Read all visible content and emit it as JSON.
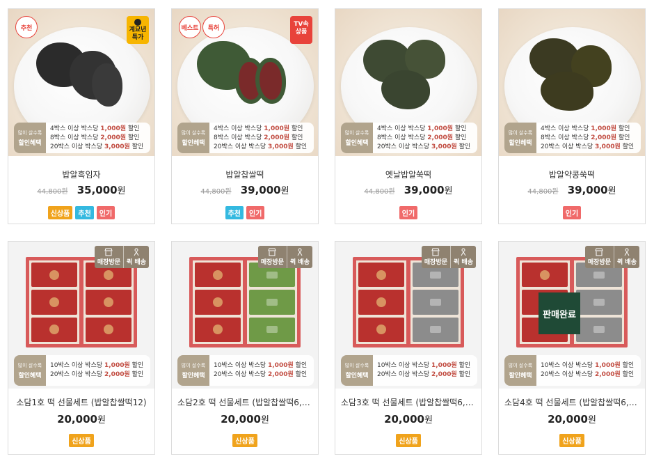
{
  "promo_label": {
    "top": "많이 살수록",
    "bottom": "할인혜택"
  },
  "pickup_tags": {
    "visit": "매장방문",
    "quick": "퀵 배송"
  },
  "sold_out": "판매완료",
  "products": [
    {
      "name": "밥알흑임자",
      "original_price": "44,800원",
      "price": "35,000",
      "price_unit": "원",
      "badges_circle": [
        "추천"
      ],
      "badge_rect": {
        "text": "계묘년\n특가",
        "color": "yellow"
      },
      "promo_lines": [
        {
          "pre": "4박스 이상 박스당 ",
          "hl": "1,000원",
          "post": " 할인"
        },
        {
          "pre": "8박스 이상 박스당 ",
          "hl": "2,000원",
          "post": " 할인"
        },
        {
          "pre": "20박스 이상 박스당 ",
          "hl": "3,000원",
          "post": " 할인"
        }
      ],
      "labels": [
        "신상품",
        "추천",
        "인기"
      ]
    },
    {
      "name": "밥알찹쌀떡",
      "original_price": "44,800원",
      "price": "39,000",
      "price_unit": "원",
      "badges_circle": [
        "베스트",
        "특허"
      ],
      "badge_rect": {
        "text": "TV속\n상품",
        "color": "red"
      },
      "promo_lines": [
        {
          "pre": "4박스 이상 박스당 ",
          "hl": "1,000원",
          "post": " 할인"
        },
        {
          "pre": "8박스 이상 박스당 ",
          "hl": "2,000원",
          "post": " 할인"
        },
        {
          "pre": "20박스 이상 박스당 ",
          "hl": "3,000원",
          "post": " 할인"
        }
      ],
      "labels": [
        "추천",
        "인기"
      ]
    },
    {
      "name": "옛날밥알쑥떡",
      "original_price": "44,800원",
      "price": "39,000",
      "price_unit": "원",
      "promo_lines": [
        {
          "pre": "4박스 이상 박스당 ",
          "hl": "1,000원",
          "post": " 할인"
        },
        {
          "pre": "8박스 이상 박스당 ",
          "hl": "2,000원",
          "post": " 할인"
        },
        {
          "pre": "20박스 이상 박스당 ",
          "hl": "3,000원",
          "post": " 할인"
        }
      ],
      "labels": [
        "인기"
      ]
    },
    {
      "name": "밥알약콩쑥떡",
      "original_price": "44,800원",
      "price": "39,000",
      "price_unit": "원",
      "promo_lines": [
        {
          "pre": "4박스 이상 박스당 ",
          "hl": "1,000원",
          "post": " 할인"
        },
        {
          "pre": "8박스 이상 박스당 ",
          "hl": "2,000원",
          "post": " 할인"
        },
        {
          "pre": "20박스 이상 박스당 ",
          "hl": "3,000원",
          "post": " 할인"
        }
      ],
      "labels": [
        "인기"
      ]
    },
    {
      "name": "소담1호 떡 선물세트 (밥알찹쌀떡12)",
      "price": "20,000",
      "price_unit": "원",
      "promo_lines": [
        {
          "pre": "10박스 이상 박스당 ",
          "hl": "1,000원",
          "post": " 할인"
        },
        {
          "pre": "20박스 이상 박스당 ",
          "hl": "2,000원",
          "post": " 할인"
        }
      ],
      "labels": [
        "신상품"
      ]
    },
    {
      "name": "소담2호 떡 선물세트 (밥알찹쌀떡6, …",
      "price": "20,000",
      "price_unit": "원",
      "promo_lines": [
        {
          "pre": "10박스 이상 박스당 ",
          "hl": "1,000원",
          "post": " 할인"
        },
        {
          "pre": "20박스 이상 박스당 ",
          "hl": "2,000원",
          "post": " 할인"
        }
      ],
      "labels": [
        "신상품"
      ]
    },
    {
      "name": "소담3호 떡 선물세트 (밥알찹쌀떡6, …",
      "price": "20,000",
      "price_unit": "원",
      "promo_lines": [
        {
          "pre": "10박스 이상 박스당 ",
          "hl": "1,000원",
          "post": " 할인"
        },
        {
          "pre": "20박스 이상 박스당 ",
          "hl": "2,000원",
          "post": " 할인"
        }
      ],
      "labels": [
        "신상품"
      ]
    },
    {
      "name": "소담4호 떡 선물세트 (밥알찹쌀떡6, …",
      "price": "20,000",
      "price_unit": "원",
      "promo_lines": [
        {
          "pre": "10박스 이상 박스당 ",
          "hl": "1,000원",
          "post": " 할인"
        },
        {
          "pre": "20박스 이상 박스당 ",
          "hl": "2,000원",
          "post": " 할인"
        }
      ],
      "labels": [
        "신상품"
      ]
    }
  ],
  "colors": {
    "label_new": "#f0a31c",
    "label_recommend": "#34b9e0",
    "label_popular": "#f06a6a",
    "promo_highlight": "#c14b40",
    "promo_label_bg": "#b1a48d"
  }
}
